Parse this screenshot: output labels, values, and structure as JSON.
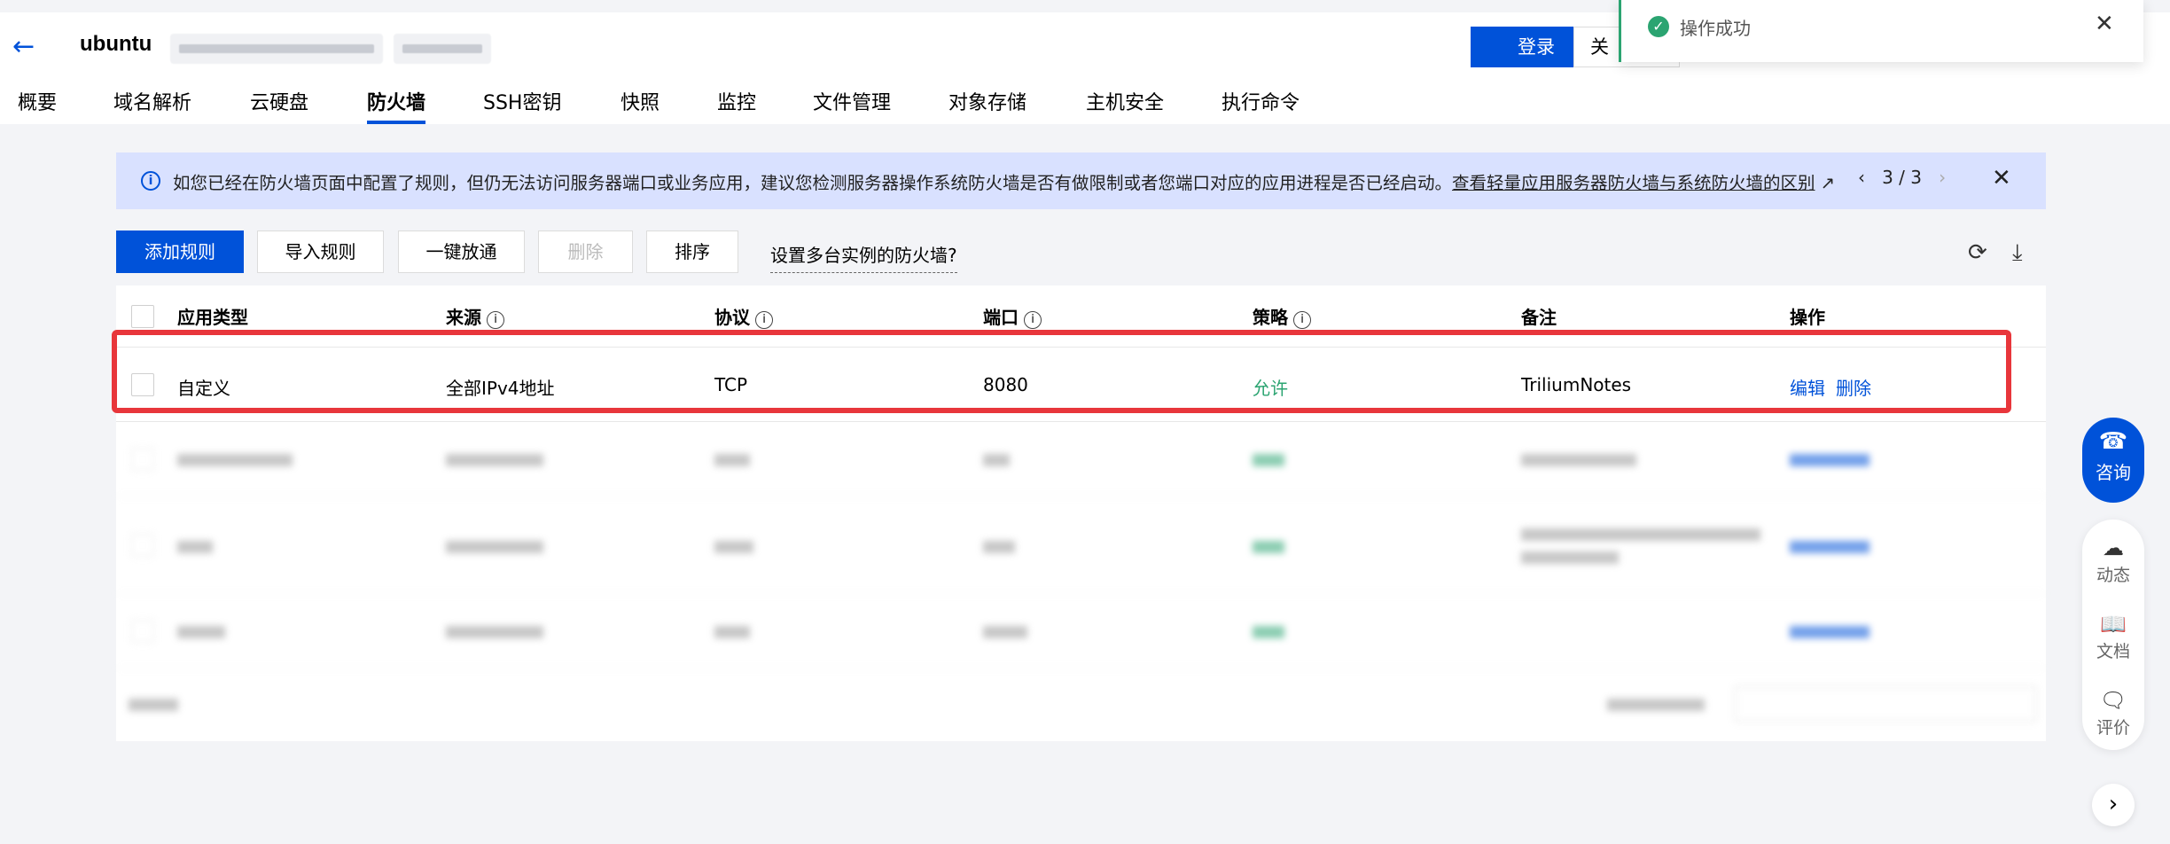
{
  "header": {
    "back_icon": "arrow-left-icon",
    "instance_name": "ubuntu",
    "login_label": "登录",
    "partial_button_label": "关"
  },
  "tabs": [
    "概要",
    "域名解析",
    "云硬盘",
    "防火墙",
    "SSH密钥",
    "快照",
    "监控",
    "文件管理",
    "对象存储",
    "主机安全",
    "执行命令"
  ],
  "active_tab": "防火墙",
  "toast": {
    "icon": "check-circle-icon",
    "message": "操作成功"
  },
  "banner": {
    "text": "如您已经在防火墙页面中配置了规则，但仍无法访问服务器端口或业务应用，建议您检测服务器操作系统防火墙是否有做限制或者您端口对应的应用进程是否已经启动。",
    "link": "查看轻量应用服务器防火墙与系统防火墙的区别",
    "pager": "3 / 3"
  },
  "toolbar": {
    "add_rule": "添加规则",
    "import_rule": "导入规则",
    "one_click_open": "一键放通",
    "delete": "删除",
    "sort": "排序",
    "multi_instance_link": "设置多台实例的防火墙?"
  },
  "table": {
    "columns": [
      "应用类型",
      "来源",
      "协议",
      "端口",
      "策略",
      "备注",
      "操作"
    ],
    "rows": [
      {
        "app_type": "自定义",
        "source": "全部IPv4地址",
        "protocol": "TCP",
        "port": "8080",
        "policy": "允许",
        "note": "TriliumNotes",
        "edit": "编辑",
        "delete": "删除"
      }
    ]
  },
  "float": {
    "consult": "咨询",
    "news": "动态",
    "docs": "文档",
    "review": "评价"
  },
  "colors": {
    "primary": "#0052d9",
    "success": "#2ba471",
    "highlight": "#e8363b",
    "banner_bg": "#d9e1ff"
  }
}
